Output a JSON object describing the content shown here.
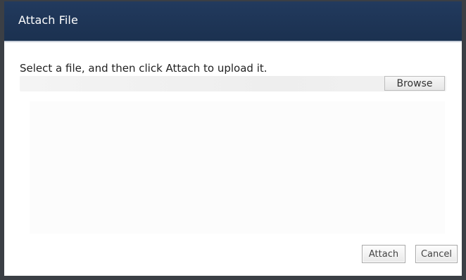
{
  "dialog": {
    "title": "Attach File",
    "instruction": "Select a file, and then click Attach to upload it.",
    "file_path_value": "",
    "browse_label": "Browse",
    "attach_label": "Attach",
    "cancel_label": "Cancel"
  },
  "colors": {
    "titlebar": "#1e3556",
    "frame": "#3b3f45",
    "title_text": "#ffffff"
  }
}
